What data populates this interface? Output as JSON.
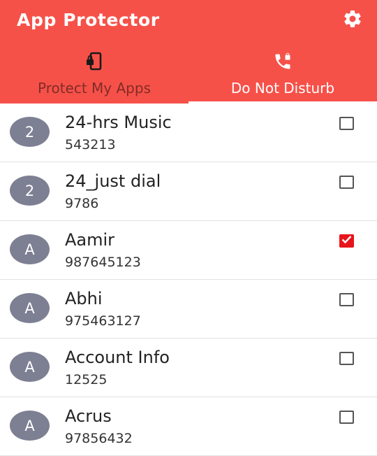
{
  "header": {
    "title": "App Protector",
    "settings_icon": "gear-icon",
    "accent_color": "#f65149"
  },
  "tabs": [
    {
      "label": "Protect My Apps",
      "icon": "phone-lock-icon",
      "active": false
    },
    {
      "label": "Do Not Disturb",
      "icon": "phone-lock-call-icon",
      "active": true
    }
  ],
  "contacts": [
    {
      "initial": "2",
      "name": "24-hrs Music",
      "number": "543213",
      "checked": false
    },
    {
      "initial": "2",
      "name": "24_just dial",
      "number": "9786",
      "checked": false
    },
    {
      "initial": "A",
      "name": "Aamir",
      "number": "987645123",
      "checked": true
    },
    {
      "initial": "A",
      "name": "Abhi",
      "number": "975463127",
      "checked": false
    },
    {
      "initial": "A",
      "name": "Account Info",
      "number": "12525",
      "checked": false
    },
    {
      "initial": "A",
      "name": "Acrus",
      "number": "97856432",
      "checked": false
    }
  ]
}
